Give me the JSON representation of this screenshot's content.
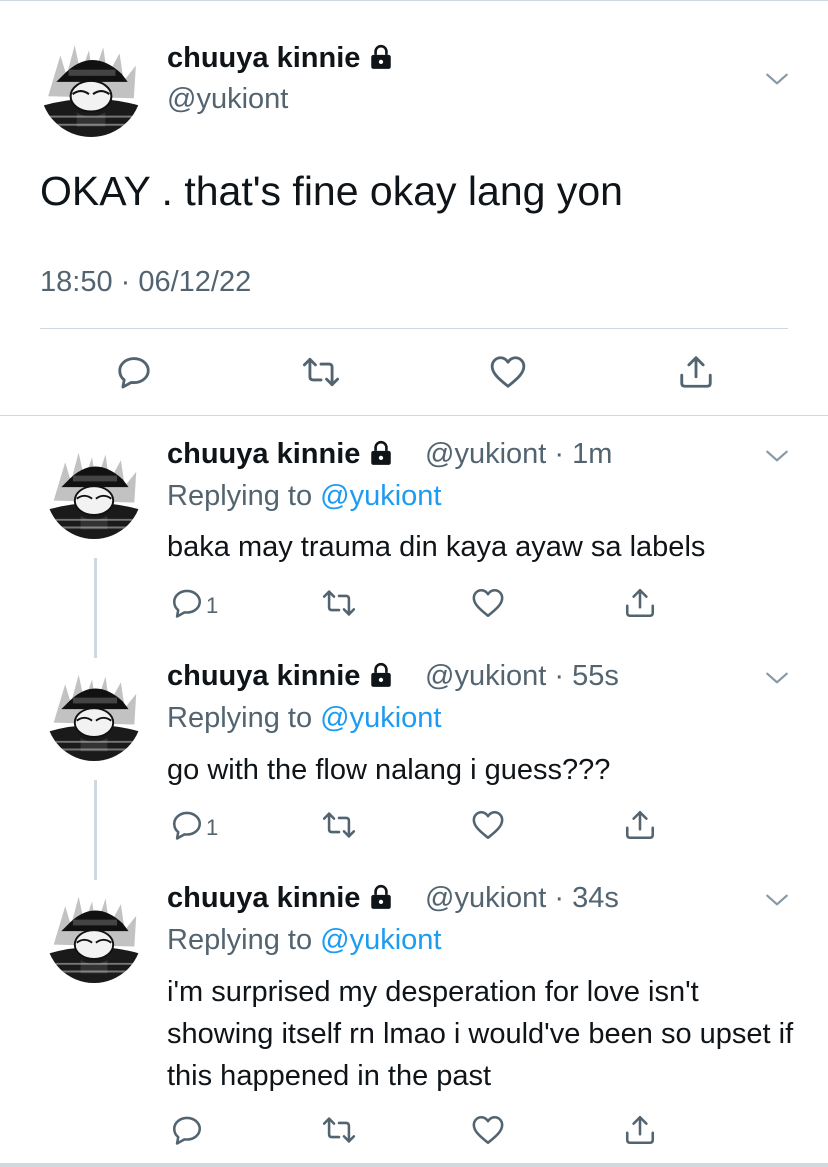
{
  "main_tweet": {
    "display_name": "chuuya kinnie",
    "handle": "@yukiont",
    "text": "OKAY . that's fine okay lang yon",
    "timestamp": "18:50 · 06/12/22"
  },
  "replies": [
    {
      "display_name": "chuuya kinnie",
      "handle_time": "@yukiont · 1m",
      "replying_prefix": "Replying to ",
      "replying_handle": "@yukiont",
      "text": "baka may trauma din kaya ayaw sa labels",
      "reply_count": "1"
    },
    {
      "display_name": "chuuya kinnie",
      "handle_time": "@yukiont · 55s",
      "replying_prefix": "Replying to ",
      "replying_handle": "@yukiont",
      "text": "go with the flow nalang i guess???",
      "reply_count": "1"
    },
    {
      "display_name": "chuuya kinnie",
      "handle_time": "@yukiont · 34s",
      "replying_prefix": "Replying to ",
      "replying_handle": "@yukiont",
      "text": "i'm surprised my desperation for love isn't showing itself rn lmao i would've been so upset if this happened in the past",
      "reply_count": ""
    }
  ],
  "icons": {
    "lock": "lock-icon",
    "chevron": "chevron-down-icon",
    "reply": "reply-icon",
    "retweet": "retweet-icon",
    "like": "heart-icon",
    "share": "share-icon"
  },
  "colors": {
    "text": "#0f1419",
    "secondary": "#536471",
    "link": "#1d9bf0",
    "divider": "#cfd9de"
  }
}
